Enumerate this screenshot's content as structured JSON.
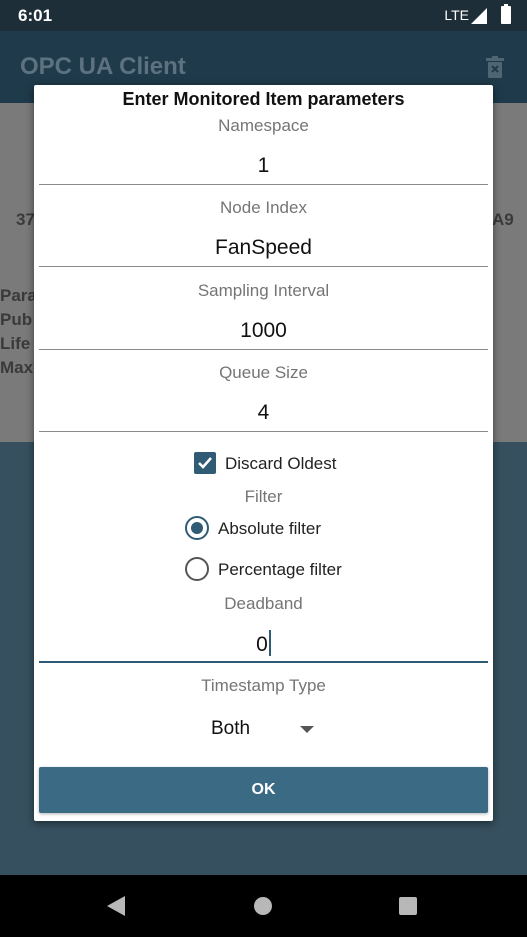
{
  "status_bar": {
    "time": "6:01",
    "network": "LTE"
  },
  "app_bar": {
    "title": "OPC UA Client",
    "action_icon": "trash-icon"
  },
  "background_fragments": {
    "left_number": "37",
    "right_text": "A9",
    "lines": [
      "Para",
      "Pub",
      "Life",
      "Max"
    ]
  },
  "dialog": {
    "title": "Enter Monitored Item parameters",
    "fields": [
      {
        "label": "Namespace",
        "value": "1"
      },
      {
        "label": "Node Index",
        "value": "FanSpeed"
      },
      {
        "label": "Sampling Interval",
        "value": "1000"
      },
      {
        "label": "Queue Size",
        "value": "4"
      }
    ],
    "discard_oldest": {
      "label": "Discard Oldest",
      "checked": true
    },
    "filter": {
      "label": "Filter",
      "options": [
        {
          "label": "Absolute filter",
          "selected": true
        },
        {
          "label": "Percentage filter",
          "selected": false
        }
      ]
    },
    "deadband": {
      "label": "Deadband",
      "value": "0"
    },
    "timestamp_type": {
      "label": "Timestamp Type",
      "selected": "Both"
    },
    "ok_label": "OK"
  },
  "colors": {
    "accent": "#2f5c74",
    "button": "#3a6a84",
    "app_bar": "#1f3a4a"
  }
}
